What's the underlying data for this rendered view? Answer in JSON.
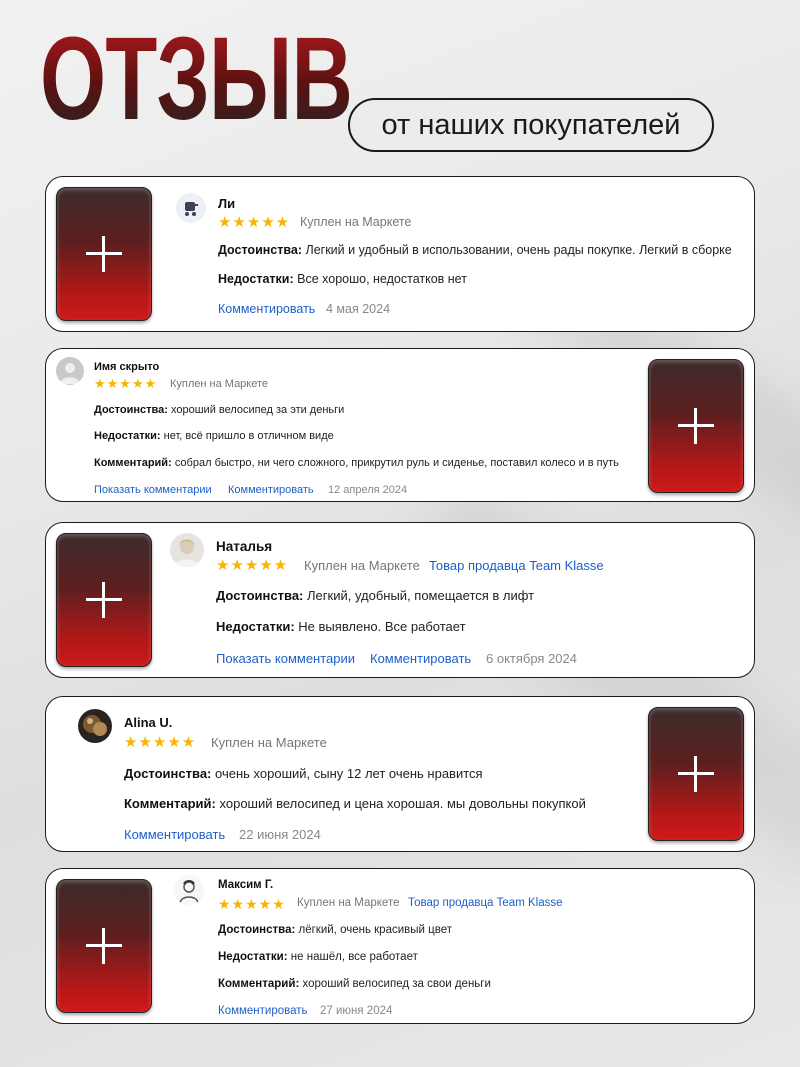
{
  "header": {
    "title": "ОТЗЫВ",
    "subtitle": "от наших покупателей"
  },
  "colors": {
    "accent_red": "#c41a1a",
    "link_blue": "#1d5fc9",
    "star_yellow": "#f7b500",
    "meta_gray": "#767676"
  },
  "stars": "★★★★★",
  "reviews": [
    {
      "name": "Ли",
      "purchase": "Куплен на Маркете",
      "rows": [
        {
          "label": "Достоинства:",
          "text": "Легкий и удобный в использовании, очень рады покупке. Легкий в сборке"
        },
        {
          "label": "Недостатки:",
          "text": "Все хорошо, недостатков нет"
        }
      ],
      "comment_link": "Комментировать",
      "date": "4 мая 2024",
      "avatar_icon": "stroller-icon"
    },
    {
      "name": "Имя скрыто",
      "purchase": "Куплен на Маркете",
      "rows": [
        {
          "label": "Достоинства:",
          "text": "хороший велосипед за эти деньги"
        },
        {
          "label": "Недостатки:",
          "text": "нет, всё пришло в отличном виде"
        },
        {
          "label": "Комментарий:",
          "text": "собрал быстро, ни чего сложного, прикрутил руль и сиденье, поставил колесо и в путь"
        }
      ],
      "show_comments": "Показать комментарии",
      "comment_link": "Комментировать",
      "date": "12 апреля 2024",
      "avatar_icon": "anonymous-user-icon"
    },
    {
      "name": "Наталья",
      "purchase": "Куплен на Маркете",
      "seller": "Товар продавца Team Klasse",
      "rows": [
        {
          "label": "Достоинства:",
          "text": "Легкий, удобный, помещается в лифт"
        },
        {
          "label": "Недостатки:",
          "text": "Не выявлено. Все работает"
        }
      ],
      "show_comments": "Показать комментарии",
      "comment_link": "Комментировать",
      "date": "6 октября 2024",
      "avatar_icon": "user-photo"
    },
    {
      "name": "Alina U.",
      "purchase": "Куплен на Маркете",
      "rows": [
        {
          "label": "Достоинства:",
          "text": "очень хороший, сыну 12 лет очень нравится"
        },
        {
          "label": "Комментарий:",
          "text": "хороший велосипед и цена хорошая. мы довольны покупкой"
        }
      ],
      "comment_link": "Комментировать",
      "date": "22 июня 2024",
      "avatar_icon": "user-photo"
    },
    {
      "name": "Максим Г.",
      "purchase": "Куплен на Маркете",
      "seller": "Товар продавца Team Klasse",
      "rows": [
        {
          "label": "Достоинства:",
          "text": "лёгкий, очень красивый цвет"
        },
        {
          "label": "Недостатки:",
          "text": "не нашёл, все работает"
        },
        {
          "label": "Комментарий:",
          "text": "хороший велосипед за свои деньги"
        }
      ],
      "comment_link": "Комментировать",
      "date": "27 июня 2024",
      "avatar_icon": "user-sketch-icon"
    }
  ]
}
